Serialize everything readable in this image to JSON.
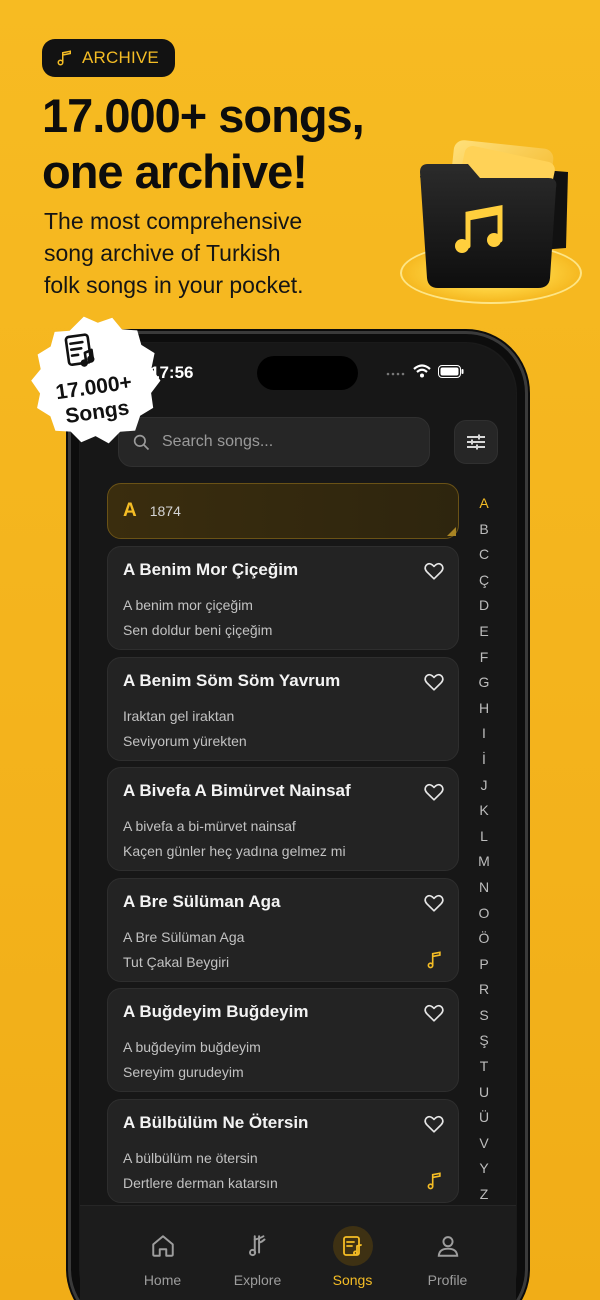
{
  "promo": {
    "badge_label": "ARCHIVE",
    "headline_line1": "17.000+ songs,",
    "headline_line2": "one archive!",
    "subline_line1": "The most comprehensive",
    "subline_line2": "song archive of Turkish",
    "subline_line3": "folk songs in your pocket.",
    "sticker_line1": "17.000+",
    "sticker_line2": "Songs",
    "folder_icon": "music-folder-icon"
  },
  "status_bar": {
    "time": "17:56"
  },
  "search": {
    "placeholder": "Search songs...",
    "icon": "search-icon"
  },
  "filter": {
    "icon": "sliders-icon"
  },
  "section": {
    "letter": "A",
    "count": "1874"
  },
  "songs": [
    {
      "title": "A Benim Mor Çiçeğim",
      "line1": "A benim mor çiçeğim",
      "line2": "Sen doldur beni çiçeğim",
      "has_audio": false
    },
    {
      "title": "A Benim Söm Söm Yavrum",
      "line1": "Iraktan gel iraktan",
      "line2": "Seviyorum yürekten",
      "has_audio": false
    },
    {
      "title": "A Bivefa A Bimürvet Nainsaf",
      "line1": "A bivefa a bi-mürvet nainsaf",
      "line2": "Kaçen günler heç yadına gelmez mi",
      "has_audio": false
    },
    {
      "title": "A Bre Sülüman Aga",
      "line1": "A Bre Sülüman Aga",
      "line2": "Tut Çakal Beygiri",
      "has_audio": true
    },
    {
      "title": "A Buğdeyim Buğdeyim",
      "line1": "A buğdeyim buğdeyim",
      "line2": "Sereyim gurudeyim",
      "has_audio": false
    },
    {
      "title": "A Bülbülüm Ne Ötersin",
      "line1": "A bülbülüm ne ötersin",
      "line2": "Dertlere derman katarsın",
      "has_audio": true
    }
  ],
  "alphabet": [
    "A",
    "B",
    "C",
    "Ç",
    "D",
    "E",
    "F",
    "G",
    "H",
    "I",
    "İ",
    "J",
    "K",
    "L",
    "M",
    "N",
    "O",
    "Ö",
    "P",
    "R",
    "S",
    "Ş",
    "T",
    "U",
    "Ü",
    "V",
    "Y",
    "Z"
  ],
  "alphabet_active": "A",
  "tabs": [
    {
      "label": "Home",
      "icon": "home-icon"
    },
    {
      "label": "Explore",
      "icon": "explore-icon"
    },
    {
      "label": "Songs",
      "icon": "songs-icon"
    },
    {
      "label": "Profile",
      "icon": "profile-icon"
    }
  ],
  "tab_active": "Songs",
  "colors": {
    "accent": "#f5bd25",
    "background": "#f4b41d",
    "screen": "#171717",
    "card": "#232323"
  }
}
